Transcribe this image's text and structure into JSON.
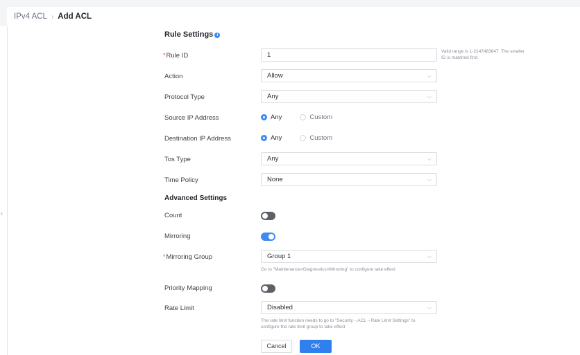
{
  "breadcrumb": {
    "root": "IPv4 ACL",
    "separator": "›",
    "current": "Add ACL"
  },
  "rule_settings": {
    "title": "Rule Settings"
  },
  "fields": {
    "rule_id": {
      "label": "Rule ID",
      "value": "1",
      "hint_line1": "Valid range is 1-2147483647. The smaller",
      "hint_line2": "ID is matched first."
    },
    "action": {
      "label": "Action",
      "value": "Allow"
    },
    "protocol_type": {
      "label": "Protocol Type",
      "value": "Any"
    },
    "source_ip": {
      "label": "Source IP Address",
      "option_any": "Any",
      "option_custom": "Custom",
      "selected": "Any"
    },
    "destination_ip": {
      "label": "Destination IP Address",
      "option_any": "Any",
      "option_custom": "Custom",
      "selected": "Any"
    },
    "tos_type": {
      "label": "Tos Type",
      "value": "Any"
    },
    "time_policy": {
      "label": "Time Policy",
      "value": "None"
    }
  },
  "advanced_settings": {
    "title": "Advanced Settings",
    "count": {
      "label": "Count",
      "enabled": false
    },
    "mirroring": {
      "label": "Mirroring",
      "enabled": true
    },
    "mirroring_group": {
      "label": "Mirroring Group",
      "value": "Group 1",
      "hint": "Go to \"Maintenance>Diagnostics>Mirroring\" to configure take effect"
    },
    "priority_mapping": {
      "label": "Priority Mapping",
      "enabled": false
    },
    "rate_limit": {
      "label": "Rate Limit",
      "value": "Disabled",
      "hint_line1": "The rate limit function needs to go to \"Security→ACL→Rate Limit Settings\" to",
      "hint_line2": "configure the rate limit group to take effect"
    }
  },
  "buttons": {
    "cancel": "Cancel",
    "ok": "OK"
  },
  "icons": {
    "info": "info-icon",
    "dropdown": "chevron-down-icon",
    "collapse": "chevron-left-icon"
  },
  "colors": {
    "accent": "#3d8bf2",
    "required": "#e5484d",
    "toggle_off": "#5c6067"
  }
}
